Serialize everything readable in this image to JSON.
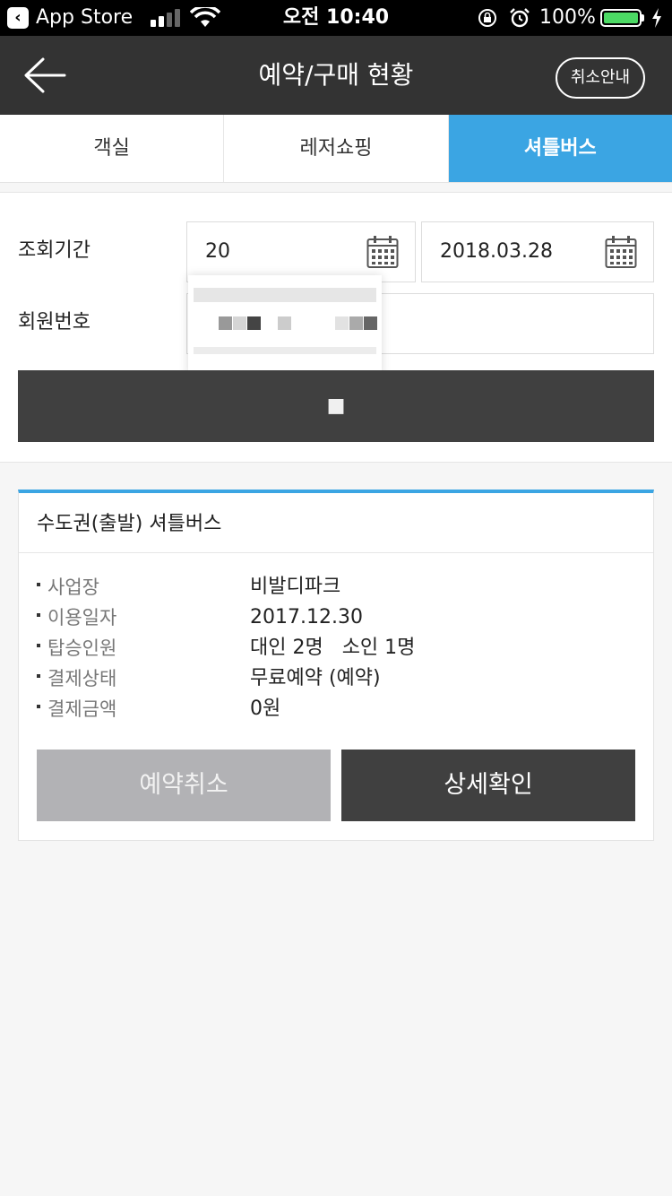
{
  "status_bar": {
    "back_app": "App Store",
    "time": "오전 10:40",
    "battery_percent": "100%",
    "signal_bars": 4,
    "signal_active": 2,
    "battery_level": 1.0
  },
  "header": {
    "title": "예약/구매 현황",
    "cancel_guide_label": "취소안내",
    "back_icon": "arrow-left-icon"
  },
  "tabs": [
    {
      "label": "객실",
      "active": false
    },
    {
      "label": "레저쇼핑",
      "active": false
    },
    {
      "label": "셔틀버스",
      "active": true
    }
  ],
  "search": {
    "period_label": "조회기간",
    "start_date": "20",
    "end_date": "2018.03.28",
    "member_label": "회원번호",
    "member_number": "",
    "search_button_label": "■",
    "calendar_icon": "calendar-icon"
  },
  "reservation": {
    "title": "수도권(출발) 셔틀버스",
    "details": [
      {
        "label": "사업장",
        "value": "비발디파크"
      },
      {
        "label": "이용일자",
        "value": "2017.12.30"
      },
      {
        "label": "탑승인원",
        "value": "대인 2명   소인 1명"
      },
      {
        "label": "결제상태",
        "value": "무료예약 (예약)"
      },
      {
        "label": "결제금액",
        "value": "0원"
      }
    ],
    "cancel_button_label": "예약취소",
    "detail_button_label": "상세확인"
  },
  "colors": {
    "accent": "#3ba5e3",
    "header_bg": "#333333",
    "dark_button": "#404040",
    "disabled_button": "#b2b2b5",
    "battery": "#4cd964"
  }
}
